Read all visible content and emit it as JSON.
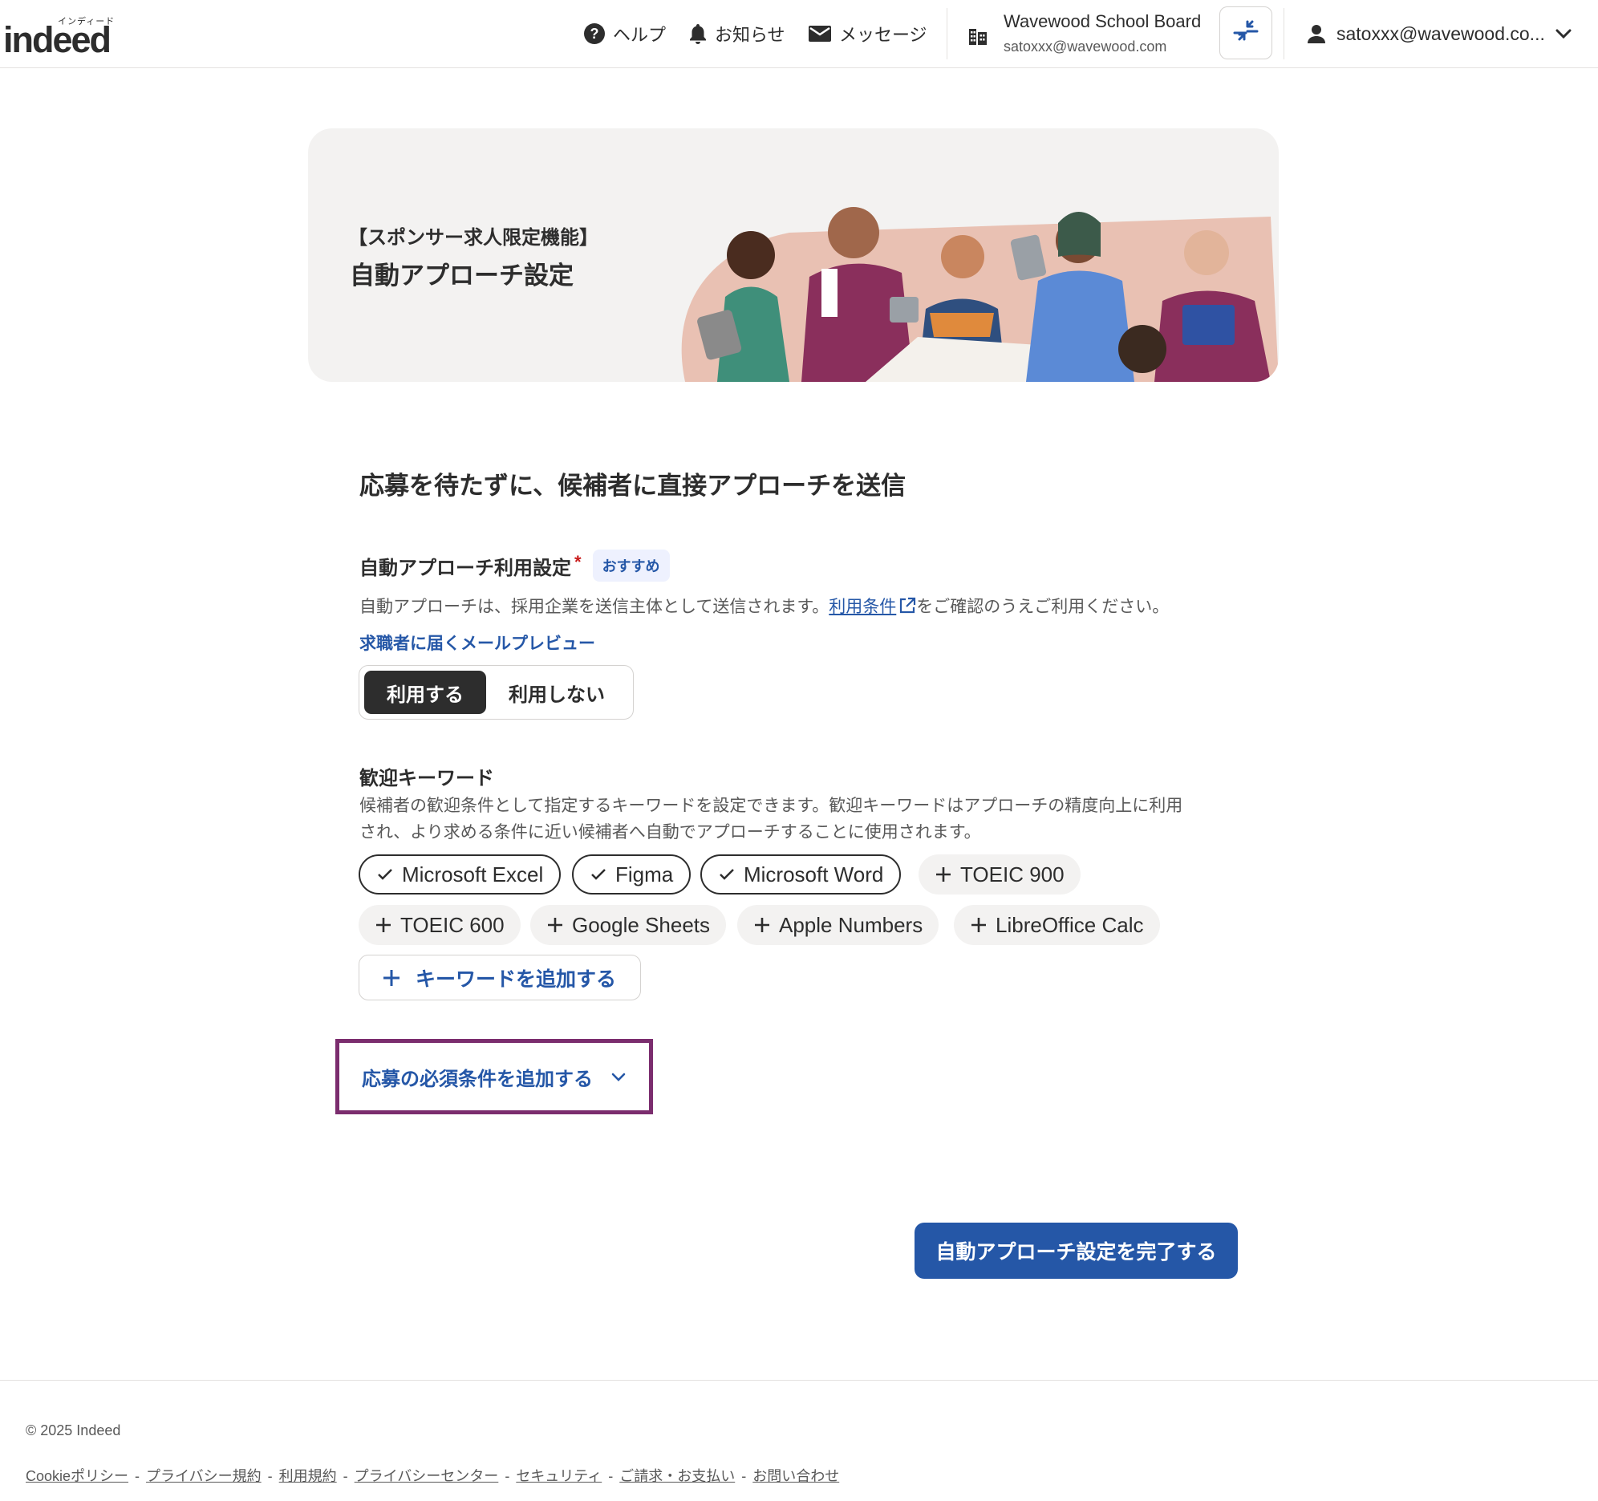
{
  "header": {
    "logo_text": "indeed",
    "logo_kana": "インディード",
    "nav": {
      "help": "ヘルプ",
      "notifications": "お知らせ",
      "messages": "メッセージ"
    },
    "org": {
      "name": "Wavewood School Board",
      "email": "satoxxx@wavewood.com"
    },
    "account_label": "satoxxx@wavewood.co..."
  },
  "banner": {
    "subtitle": "【スポンサー求人限定機能】",
    "title": "自動アプローチ設定"
  },
  "main": {
    "heading": "応募を待たずに、候補者に直接アプローチを送信",
    "usage": {
      "label": "自動アプローチ利用設定",
      "required_mark": "*",
      "badge": "おすすめ",
      "description_before": "自動アプローチは、採用企業を送信主体として送信されます。",
      "terms_link": "利用条件",
      "description_after": "をご確認のうえご利用ください。",
      "preview_link": "求職者に届くメールプレビュー",
      "option_use": "利用する",
      "option_not_use": "利用しない",
      "selected": "利用する"
    },
    "keywords": {
      "label": "歓迎キーワード",
      "description_line1": "候補者の歓迎条件として指定するキーワードを設定できます。歓迎キーワードはアプローチの精度向上に利用",
      "description_line2": "され、より求める条件に近い候補者へ自動でアプローチすることに使用されます。",
      "chips": [
        {
          "label": "Microsoft Excel",
          "selected": true
        },
        {
          "label": "Figma",
          "selected": true
        },
        {
          "label": "Microsoft Word",
          "selected": true
        },
        {
          "label": "TOEIC 900",
          "selected": false
        },
        {
          "label": "TOEIC 600",
          "selected": false
        },
        {
          "label": "Google Sheets",
          "selected": false
        },
        {
          "label": "Apple Numbers",
          "selected": false
        },
        {
          "label": "LibreOffice Calc",
          "selected": false
        }
      ],
      "add_button": "キーワードを追加する"
    },
    "required_conditions_toggle": "応募の必須条件を追加する",
    "complete_button": "自動アプローチ設定を完了する"
  },
  "footer": {
    "copyright": "© 2025 Indeed",
    "links": [
      "Cookieポリシー",
      "プライバシー規約",
      "利用規約",
      "プライバシーセンター",
      "セキュリティ",
      "ご請求・お支払い",
      "お問い合わせ"
    ]
  },
  "colors": {
    "accent_blue": "#2557a7",
    "dark": "#2d2d2d",
    "highlight_frame": "#7b2d6e",
    "banner_bg": "#f3f2f1"
  }
}
